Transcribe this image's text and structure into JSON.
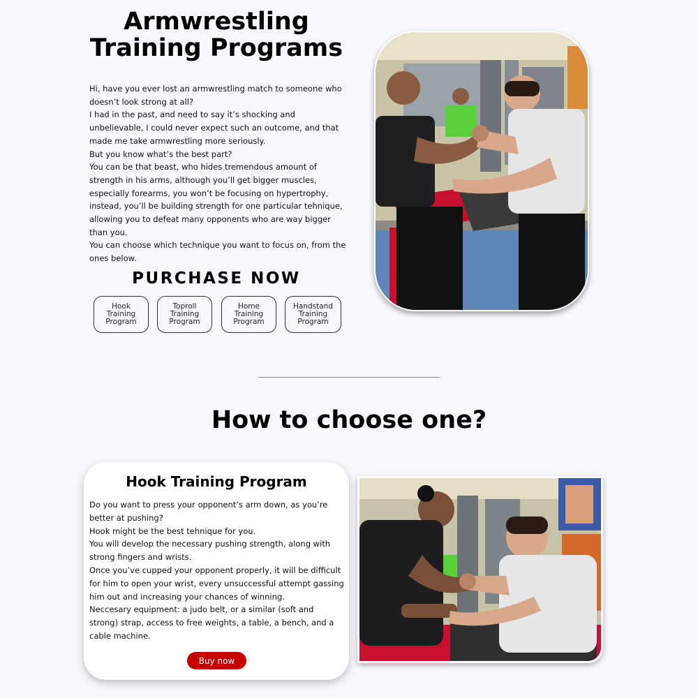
{
  "hero": {
    "title_line1": "Armwrestling",
    "title_line2": "Training Programs",
    "intro": [
      "Hi, have you ever lost an armwrestling match to someone who doesn’t look strong at all?",
      "I had in the past, and need to say it’s shocking and unbelievable, I could never expect such an outcome, and that made me take armwrestling more seriously.",
      "But you know what’s the best part?",
      "You can be that beast, who hides tremendous amount of strength in his arms, although you’ll get bigger muscles, especially forearms, you won’t be focusing on hypertrophy, instead, you’ll be building strength for one particular tehnique, allowing you to defeat many opponents who are way bigger than you.",
      "You can choose which technique you want to focus on, from the ones below."
    ]
  },
  "purchase": {
    "heading": "PURCHASE NOW",
    "programs": [
      {
        "line1": "Hook",
        "line2": "Training",
        "line3": "Program"
      },
      {
        "line1": "Toproll",
        "line2": "Training",
        "line3": "Program"
      },
      {
        "line1": "Home",
        "line2": "Training",
        "line3": "Program"
      },
      {
        "line1": "Handstand",
        "line2": "Training",
        "line3": "Program"
      }
    ]
  },
  "choose": {
    "title": "How to choose one?",
    "card": {
      "title": "Hook Training Program",
      "paragraphs": [
        "Do you want to press your opponent’s arm down, as you’re better at pushing?",
        "Hook might be the best tehnique for you.",
        "You will develop the necessary pushing strength, along with strong fingers and wrists.",
        "Once you’ve cupped your opponent properly, it will be difficult for him to open your wrist, every unsuccessful attempt gassing him out and increasing your chances of winning.",
        "Neccesary equipment: a judo belt, or a similar (soft and strong) strap, access to free weights, a table, a bench, and a cable machine."
      ],
      "button_label": "Buy now"
    }
  },
  "colors": {
    "background": "#f7f9fc",
    "buy_button": "#c60000",
    "table_red": "#c8102e"
  }
}
